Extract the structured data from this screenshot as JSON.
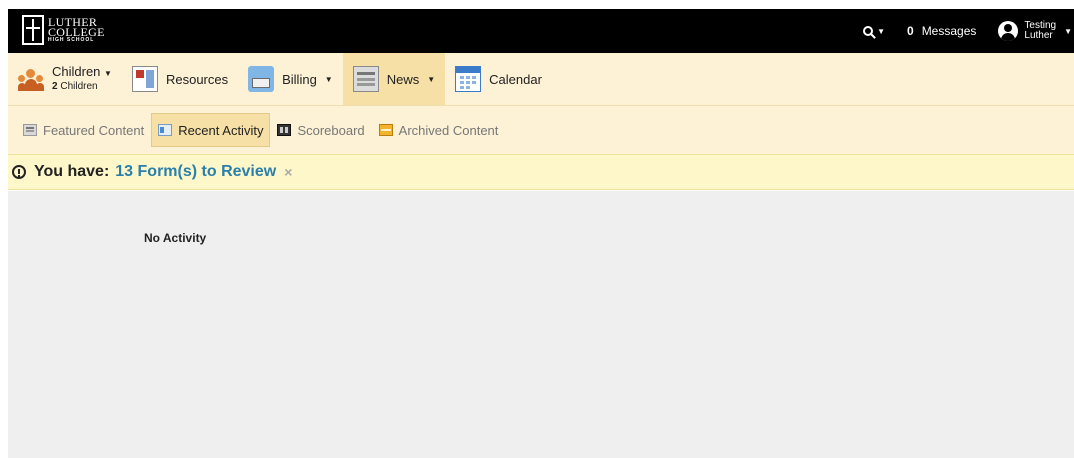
{
  "logo": {
    "line1": "LUTHER",
    "line2": "COLLEGE",
    "line3": "HIGH SCHOOL"
  },
  "topbar": {
    "messages_count": "0",
    "messages_label": "Messages",
    "user_first": "Testing",
    "user_last": "Luther"
  },
  "mainnav": {
    "children_label": "Children",
    "children_count": "2",
    "children_sub": "Children",
    "resources": "Resources",
    "billing": "Billing",
    "news": "News",
    "calendar": "Calendar"
  },
  "subnav": {
    "featured": "Featured Content",
    "recent": "Recent Activity",
    "scoreboard": "Scoreboard",
    "archived": "Archived Content"
  },
  "alert": {
    "prefix": "You have:",
    "link": "13 Form(s) to Review",
    "close": "×"
  },
  "content": {
    "empty_text": "No Activity"
  },
  "icons": {
    "search": "search-icon",
    "user": "user-avatar-icon",
    "alert": "alert-circle-icon"
  },
  "colors": {
    "topbar": "#000000",
    "nav_bg": "#fdf1d6",
    "nav_active": "#f6e0a6",
    "alert_bg": "#fdf7c9",
    "link": "#2a7fab",
    "content_bg": "#efefef"
  }
}
